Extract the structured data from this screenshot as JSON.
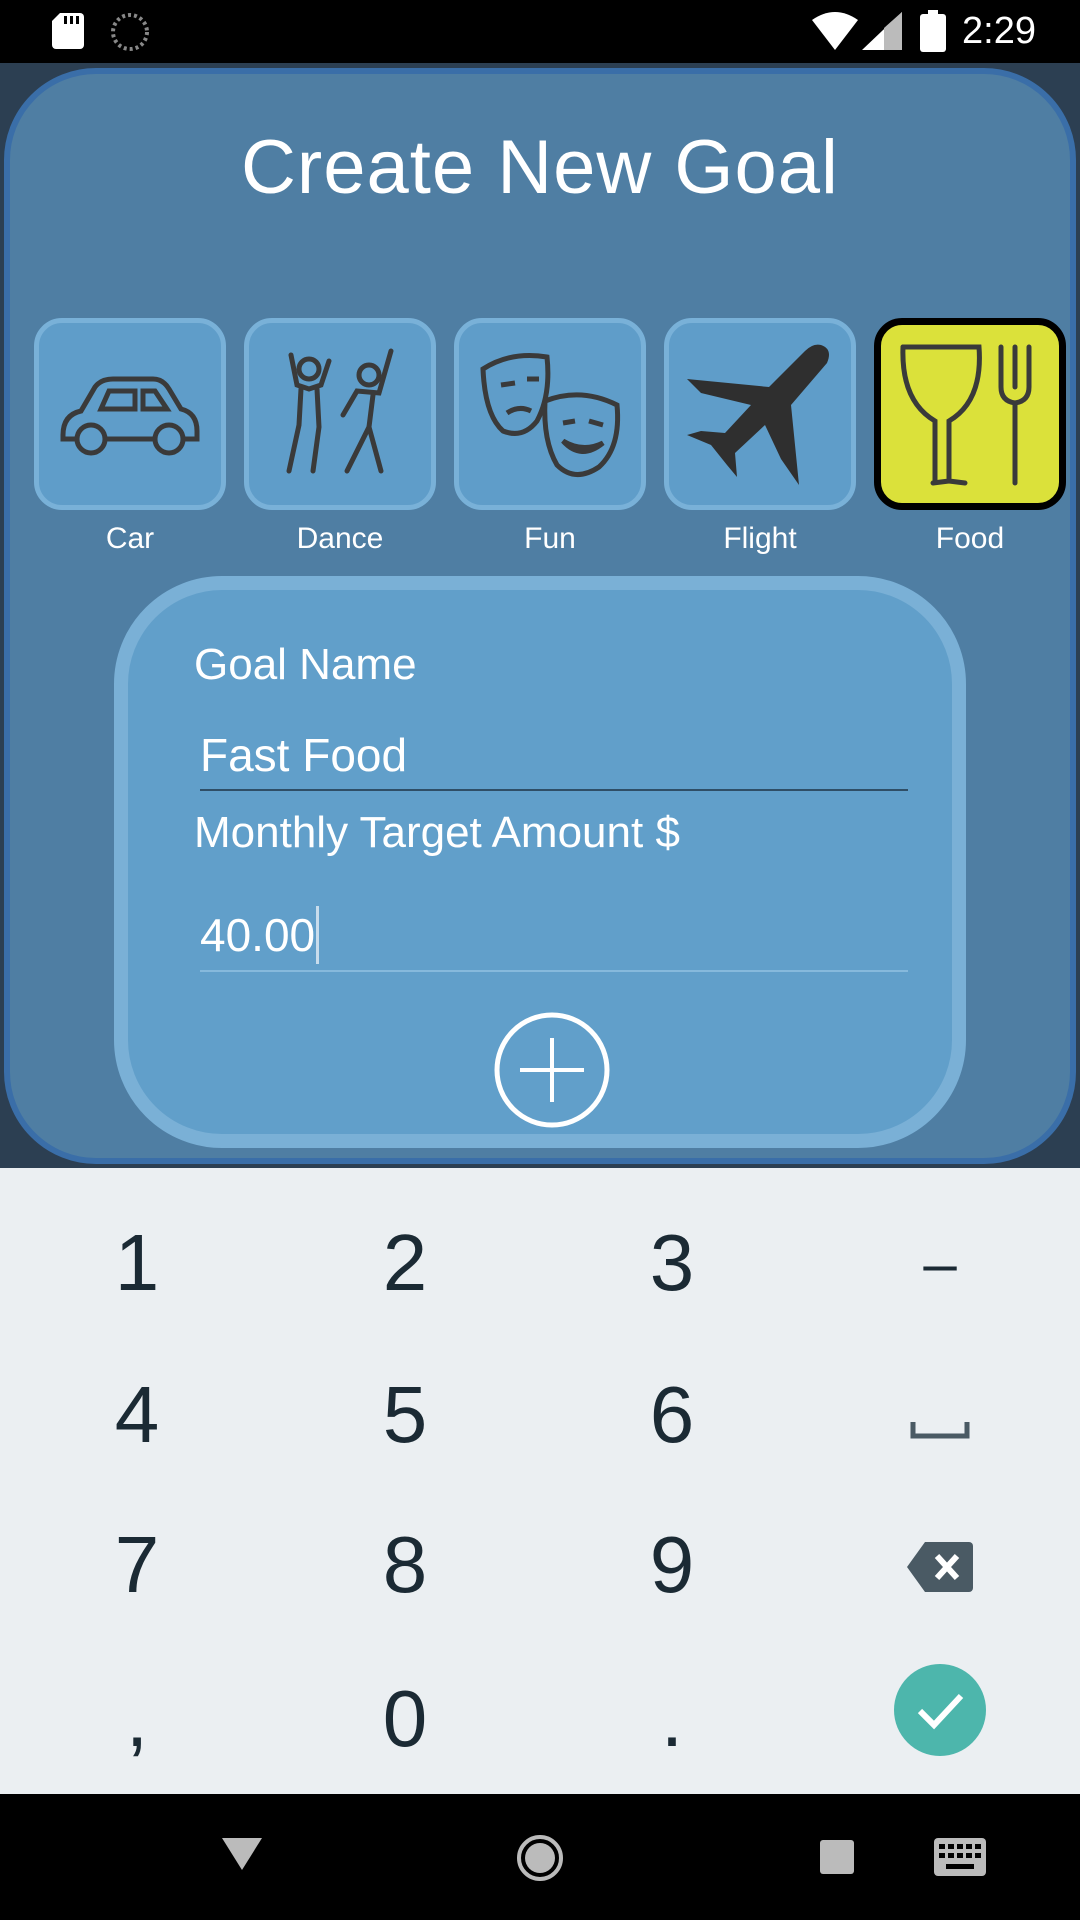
{
  "status_bar": {
    "time": "2:29"
  },
  "dialog": {
    "title": "Create New Goal",
    "categories": [
      {
        "label": "Car",
        "icon": "car-icon"
      },
      {
        "label": "Dance",
        "icon": "dance-icon"
      },
      {
        "label": "Fun",
        "icon": "theater-masks-icon"
      },
      {
        "label": "Flight",
        "icon": "airplane-icon"
      },
      {
        "label": "Food",
        "icon": "glass-fork-icon",
        "selected": true
      }
    ],
    "form": {
      "goal_name_label": "Goal Name",
      "goal_name_value": "Fast Food",
      "amount_label": "Monthly Target Amount $",
      "amount_value": "40.00",
      "add_icon": "add-circle-icon"
    },
    "colors": {
      "panel": "#4f7ea3",
      "tile": "#5f9dc9",
      "selected_tile": "#dbe13a"
    }
  },
  "keyboard": {
    "keys": [
      "1",
      "2",
      "3",
      "–",
      "4",
      "5",
      "6",
      "␣",
      "7",
      "8",
      "9",
      "⌫",
      ",",
      "0",
      "."
    ],
    "done_color": "#4db6ac"
  }
}
